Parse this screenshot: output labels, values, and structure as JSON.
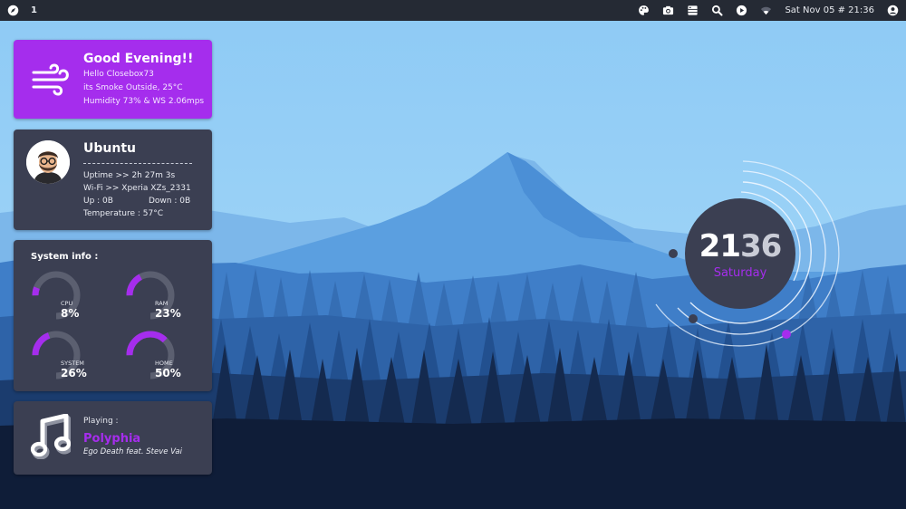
{
  "topbar": {
    "workspace": "1",
    "clock": "Sat Nov 05 # 21:36",
    "icons": [
      "compass-icon",
      "palette-icon",
      "camera-icon",
      "files-icon",
      "search-icon",
      "play-icon",
      "wifi-icon",
      "user-icon"
    ]
  },
  "greeting": {
    "title": "Good Evening!!",
    "hello": "Hello Closebox73",
    "weather": "its Smoke Outside, 25°C",
    "humidity": "Humidity 73% & WS 2.06mps",
    "icon": "wind-icon"
  },
  "system": {
    "os": "Ubuntu",
    "uptime": "Uptime >> 2h 27m 3s",
    "wifi": "Wi-Fi >> Xperia XZs_2331",
    "up": "Up : 0B",
    "down": "Down : 0B",
    "temperature": "Temperature : 57°C"
  },
  "sysinfo": {
    "header": "System info :",
    "gauges": [
      {
        "name": "CPU",
        "value": "8%",
        "fraction": 0.08
      },
      {
        "name": "RAM",
        "value": "23%",
        "fraction": 0.23
      },
      {
        "name": "SYSTEM",
        "value": "26%",
        "fraction": 0.26
      },
      {
        "name": "HOME",
        "value": "50%",
        "fraction": 0.5
      }
    ]
  },
  "music": {
    "playing_label": "Playing :",
    "artist": "Polyphia",
    "track": "Ego Death feat. Steve Vai",
    "icon": "music-note-icon"
  },
  "clock": {
    "hours": "21",
    "minutes": "36",
    "day": "Saturday"
  },
  "colors": {
    "accent": "#a52ded",
    "card": "#3b3f52",
    "topbar": "#252a34",
    "sky": "#9fd3f7"
  }
}
